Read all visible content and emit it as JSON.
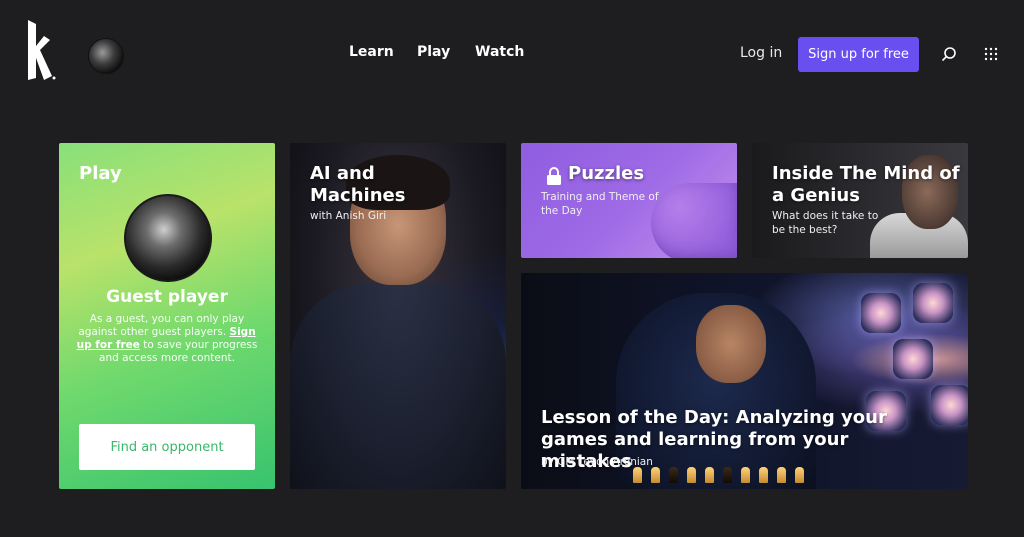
{
  "header": {
    "nav": [
      {
        "label": "Learn"
      },
      {
        "label": "Play"
      },
      {
        "label": "Watch"
      }
    ],
    "login_label": "Log in",
    "signup_label": "Sign up for free"
  },
  "cards": {
    "play": {
      "title": "Play",
      "guest_name": "Guest player",
      "desc_before": "As a guest, you can only play against other guest players. ",
      "desc_link": "Sign up for free",
      "desc_after": " to save your progress and access more content.",
      "button_label": "Find an opponent"
    },
    "ai": {
      "title": "AI and Machines",
      "subtitle": "with Anish Giri"
    },
    "puzzles": {
      "title": "Puzzles",
      "subtitle": "Training and Theme of the Day"
    },
    "genius": {
      "title": "Inside The Mind of a Genius",
      "subtitle": "What does it take to be the best?"
    },
    "lesson": {
      "title": "Lesson of the Day: Analyzing your games and learning from your mistakes",
      "subtitle": "by GM Levon Aronian"
    }
  },
  "colors": {
    "accent": "#6a4ff0",
    "background": "#1e1d1f",
    "play_green": "#4fd06c",
    "puzzle_purple": "#9e6ae6"
  }
}
